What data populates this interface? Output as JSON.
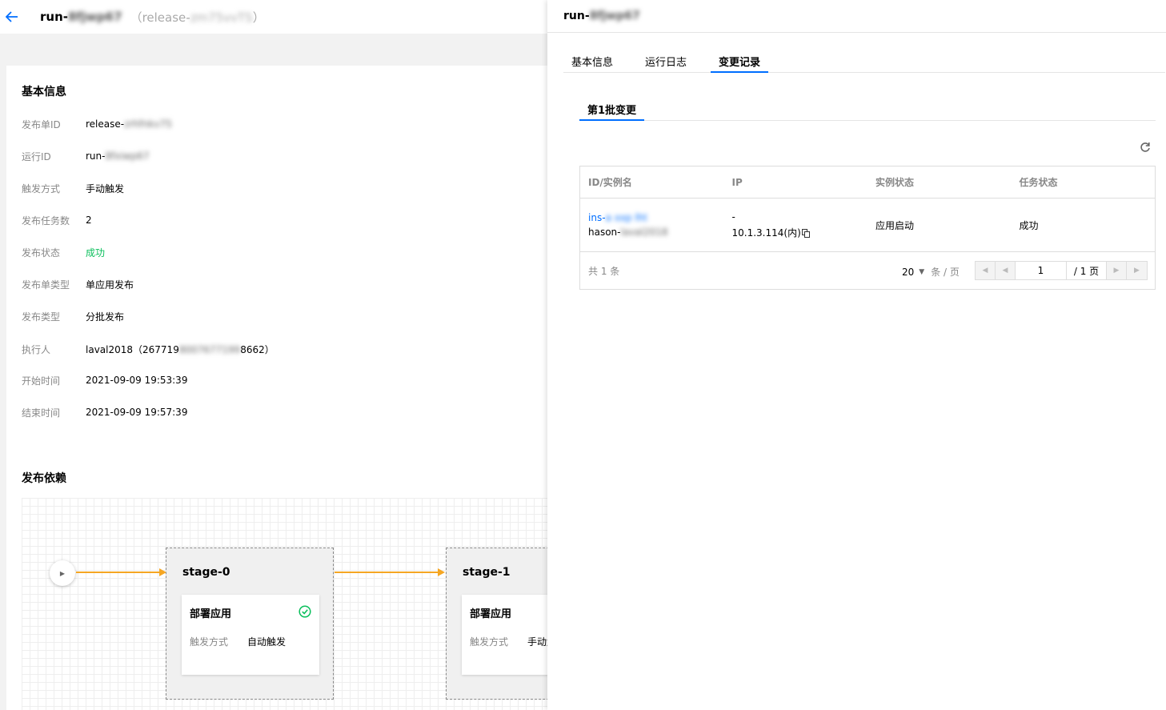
{
  "left": {
    "header": {
      "run_prefix": "run-",
      "run_blur": "8fjwp67",
      "release_prefix": "（release-",
      "release_blur": "zm75vvTS",
      "release_suffix": "）"
    },
    "basic_info": {
      "title": "基本信息",
      "rows": [
        {
          "label": "发布单ID",
          "value": "release-",
          "blur": "zrhfnkv75"
        },
        {
          "label": "运行ID",
          "value": "run-",
          "blur": "8fxiwp67"
        },
        {
          "label": "触发方式",
          "value": "手动触发",
          "blur": ""
        },
        {
          "label": "发布任务数",
          "value": "2",
          "blur": ""
        },
        {
          "label": "发布状态",
          "value": "成功",
          "blur": ""
        },
        {
          "label": "发布单类型",
          "value": "单应用发布",
          "blur": ""
        },
        {
          "label": "发布类型",
          "value": "分批发布",
          "blur": ""
        },
        {
          "label": "执行人",
          "value": "laval2018（267719",
          "blur": "8007677199",
          "suffix": "8662）"
        },
        {
          "label": "开始时间",
          "value": "2021-09-09 19:53:39",
          "blur": ""
        },
        {
          "label": "结束时间",
          "value": "2021-09-09 19:57:39",
          "blur": ""
        }
      ]
    },
    "dependency": {
      "title": "发布依赖",
      "stages": [
        {
          "name": "stage-0",
          "card_title": "部署应用",
          "trigger_label": "触发方式",
          "trigger_value": "自动触发"
        },
        {
          "name": "stage-1",
          "card_title": "部署应用",
          "trigger_label": "触发方式",
          "trigger_value": "手动触发"
        }
      ]
    }
  },
  "drawer": {
    "title_prefix": "run-",
    "title_blur": "8fjwp67",
    "tabs": [
      "基本信息",
      "运行日志",
      "变更记录"
    ],
    "active_tab": "变更记录",
    "subtab": "第1批变更",
    "table": {
      "columns": [
        "ID/实例名",
        "IP",
        "实例状态",
        "任务状态"
      ],
      "rows": [
        {
          "id_prefix": "ins-",
          "id_blur": "a xxp lht",
          "name_prefix": "hason-",
          "name_blur": "laval2018",
          "ip_public": "-",
          "ip_private": "10.1.3.114(内)",
          "instance_status": "应用启动",
          "task_status": "成功"
        }
      ],
      "total_text": "共  1  条",
      "page_size": "20",
      "page_size_unit": "条 / 页",
      "current_page": "1",
      "total_pages": "/ 1 页"
    }
  },
  "colors": {
    "accent": "#006eff",
    "success": "#0abf5b",
    "edge": "#f5a623"
  }
}
